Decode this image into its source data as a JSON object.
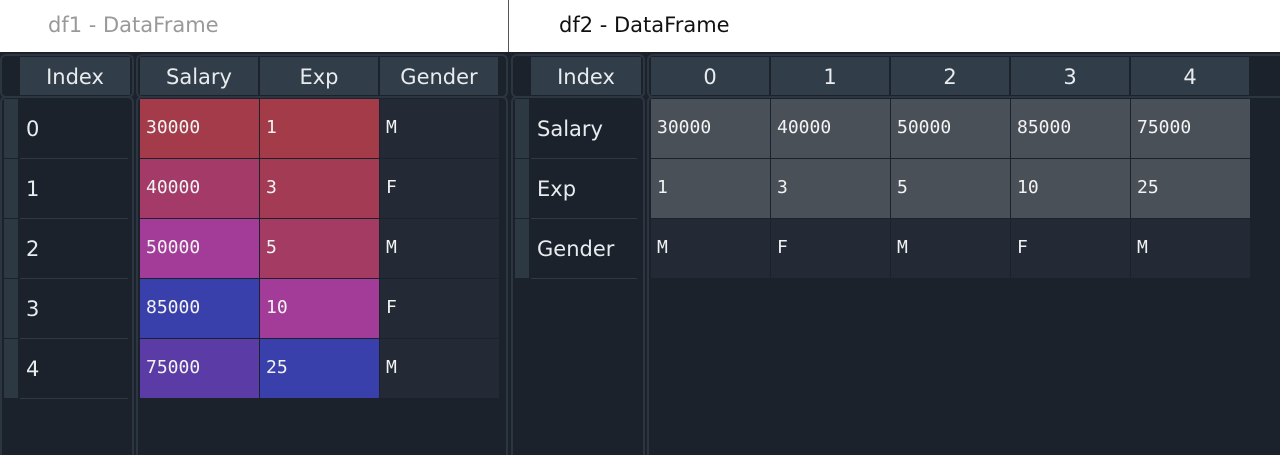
{
  "df1": {
    "title": "df1 - DataFrame",
    "index_header": "Index",
    "columns": [
      "Salary",
      "Exp",
      "Gender"
    ],
    "index": [
      "0",
      "1",
      "2",
      "3",
      "4"
    ],
    "rows": [
      [
        "30000",
        "1",
        "M"
      ],
      [
        "40000",
        "3",
        "F"
      ],
      [
        "50000",
        "5",
        "M"
      ],
      [
        "85000",
        "10",
        "F"
      ],
      [
        "75000",
        "25",
        "M"
      ]
    ],
    "cell_colors": [
      [
        "#a33b4a",
        "#a33b48",
        "#232a35"
      ],
      [
        "#a33a68",
        "#a33b54",
        "#232a35"
      ],
      [
        "#a33c98",
        "#a33b62",
        "#232a35"
      ],
      [
        "#3a40ab",
        "#a33c98",
        "#232a35"
      ],
      [
        "#5b3ba5",
        "#3a40ab",
        "#232a35"
      ]
    ]
  },
  "df2": {
    "title": "df2 - DataFrame",
    "index_header": "Index",
    "columns": [
      "0",
      "1",
      "2",
      "3",
      "4"
    ],
    "index": [
      "Salary",
      "Exp",
      "Gender"
    ],
    "rows": [
      [
        "30000",
        "40000",
        "50000",
        "85000",
        "75000"
      ],
      [
        "1",
        "3",
        "5",
        "10",
        "25"
      ],
      [
        "M",
        "F",
        "M",
        "F",
        "M"
      ]
    ],
    "row_colors": [
      "#4a5058",
      "#4a5058",
      "#232a35"
    ]
  }
}
